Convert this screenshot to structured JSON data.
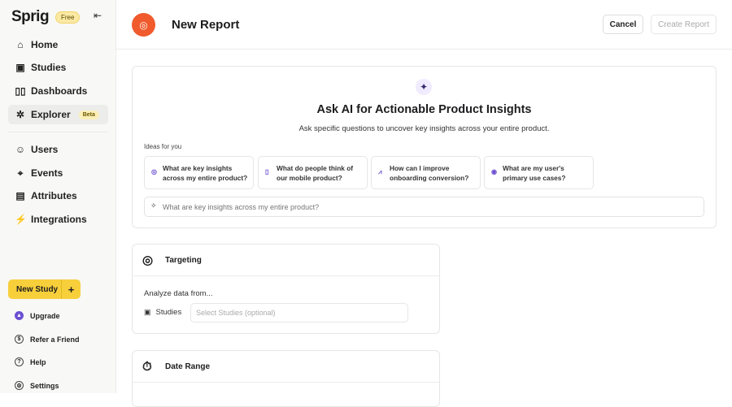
{
  "sidebar": {
    "logo": "Sprig",
    "plan_badge": "Free",
    "nav": [
      {
        "label": "Home",
        "icon": "home-icon"
      },
      {
        "label": "Studies",
        "icon": "studies-icon"
      },
      {
        "label": "Dashboards",
        "icon": "dashboards-icon"
      },
      {
        "label": "Explorer",
        "icon": "explorer-icon",
        "badge": "Beta",
        "active": true
      },
      {
        "label": "Users",
        "icon": "users-icon"
      },
      {
        "label": "Events",
        "icon": "events-icon"
      },
      {
        "label": "Attributes",
        "icon": "attributes-icon"
      },
      {
        "label": "Integrations",
        "icon": "integrations-icon"
      }
    ],
    "new_study": "New Study",
    "footer": [
      {
        "label": "Upgrade"
      },
      {
        "label": "Refer a Friend"
      },
      {
        "label": "Help"
      },
      {
        "label": "Settings"
      }
    ]
  },
  "header": {
    "title": "New Report",
    "cancel": "Cancel",
    "create": "Create Report"
  },
  "ai": {
    "title": "Ask AI for Actionable Product Insights",
    "subtitle": "Ask specific questions to uncover key insights across your entire product.",
    "ideas_label": "Ideas for you",
    "ideas": [
      "What are key insights across my entire product?",
      "What do people think of our mobile product?",
      "How can I improve onboarding conversion?",
      "What are my user's primary use cases?"
    ],
    "placeholder": "What are key insights across my entire product?"
  },
  "targeting": {
    "title": "Targeting",
    "analyze": "Analyze data from...",
    "studies_label": "Studies",
    "studies_placeholder": "Select Studies (optional)"
  },
  "date_range": {
    "title": "Date Range"
  },
  "colors": {
    "accent": "#f05a2c",
    "new_study": "#f7cf3b",
    "ai_purple": "#6b4fd1"
  }
}
